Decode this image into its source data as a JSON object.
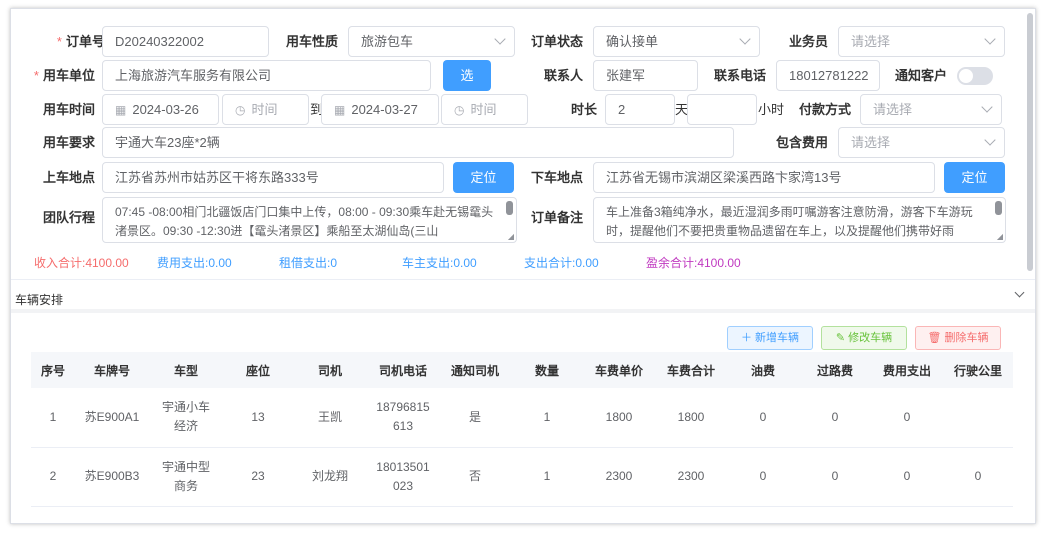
{
  "form": {
    "order_no": {
      "label": "订单号",
      "value": "D20240322002"
    },
    "usage_type": {
      "label": "用车性质",
      "value": "旅游包车"
    },
    "order_status": {
      "label": "订单状态",
      "value": "确认接单"
    },
    "salesman": {
      "label": "业务员",
      "placeholder": "请选择"
    },
    "company": {
      "label": "用车单位",
      "value": "上海旅游汽车服务有限公司",
      "select_btn": "选"
    },
    "contact": {
      "label": "联系人",
      "value": "张建军"
    },
    "phone": {
      "label": "联系电话",
      "value": "18012781222"
    },
    "notify_client": {
      "label": "通知客户",
      "on": false
    },
    "usage_time": {
      "label": "用车时间",
      "start_date": "2024-03-26",
      "start_time_ph": "时间",
      "to": "到",
      "end_date": "2024-03-27",
      "end_time_ph": "时间"
    },
    "duration": {
      "label": "时长",
      "days": "2",
      "day_unit": "天",
      "hours": "",
      "hour_unit": "小时"
    },
    "payment": {
      "label": "付款方式",
      "placeholder": "请选择"
    },
    "requirement": {
      "label": "用车要求",
      "value": "宇通大车23座*2辆"
    },
    "included_cost": {
      "label": "包含费用",
      "placeholder": "请选择"
    },
    "pickup": {
      "label": "上车地点",
      "value": "江苏省苏州市姑苏区干将东路333号",
      "locate_btn": "定位"
    },
    "dropoff": {
      "label": "下车地点",
      "value": "江苏省无锡市滨湖区梁溪西路卞家湾13号",
      "locate_btn": "定位"
    },
    "itinerary": {
      "label": "团队行程",
      "value": "07:45 -08:00相门北疆饭店门口集中上传，08:00 - 09:30乘车赴无锡鼋头渚景区。09:30 -12:30进【鼋头渚景区】乘船至太湖仙岛(三山"
    },
    "remark": {
      "label": "订单备注",
      "value": "车上准备3箱纯净水，最近湿润多雨叮嘱游客注意防滑，游客下车游玩时，提醒他们不要把贵重物品遗留在车上，以及提醒他们携带好雨"
    }
  },
  "summary": [
    {
      "text": "收入合计:4100.00",
      "color": "#f56c6c"
    },
    {
      "text": "费用支出:0.00",
      "color": "#409eff"
    },
    {
      "text": "租借支出:0",
      "color": "#409eff"
    },
    {
      "text": "车主支出:0.00",
      "color": "#409eff"
    },
    {
      "text": "支出合计:0.00",
      "color": "#409eff"
    },
    {
      "text": "盈余合计:4100.00",
      "color": "#c039c0"
    }
  ],
  "vehicles": {
    "title": "车辆安排",
    "add_btn": "新增车辆",
    "edit_btn": "修改车辆",
    "delete_btn": "删除车辆",
    "columns": [
      "序号",
      "车牌号",
      "车型",
      "座位",
      "司机",
      "司机电话",
      "通知司机",
      "数量",
      "车费单价",
      "车费合计",
      "油费",
      "过路费",
      "费用支出",
      "行驶公里"
    ],
    "rows": [
      [
        "1",
        "苏E900A1",
        "宇通小车经济",
        "13",
        "王凯",
        "18796815613",
        "是",
        "1",
        "1800",
        "1800",
        "0",
        "0",
        "0",
        ""
      ],
      [
        "2",
        "苏E900B3",
        "宇通中型商务",
        "23",
        "刘龙翔",
        "18013501023",
        "否",
        "1",
        "2300",
        "2300",
        "0",
        "0",
        "0",
        "0"
      ]
    ]
  },
  "colors": {
    "primary": "#409eff",
    "success": "#67c23a",
    "danger": "#f56c6c",
    "required": "#f56c6c"
  }
}
